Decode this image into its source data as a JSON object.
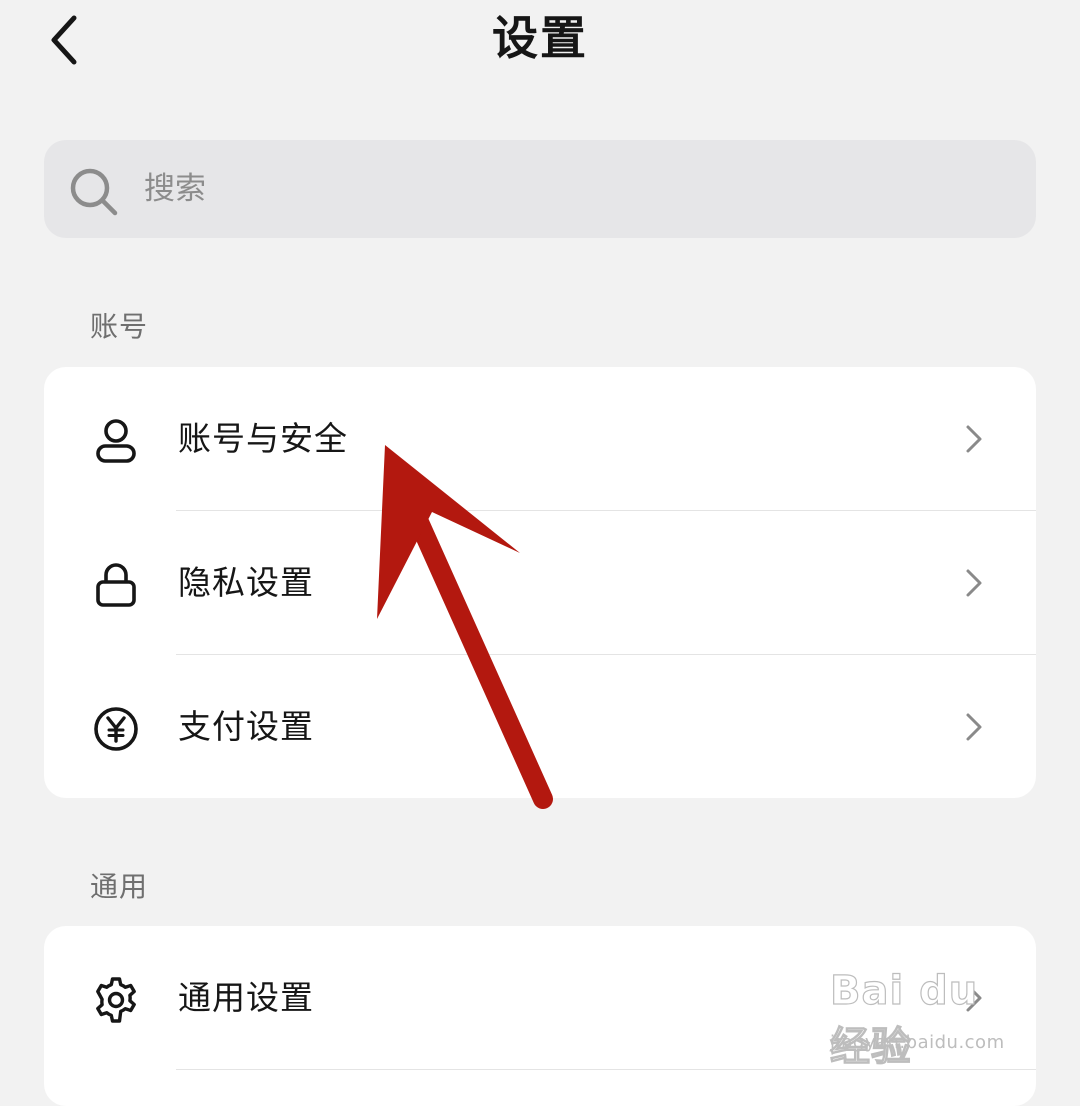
{
  "header": {
    "title": "设置",
    "back_icon": "chevron-left-icon"
  },
  "search": {
    "placeholder": "搜索",
    "value": "",
    "icon": "search-icon"
  },
  "sections": [
    {
      "label": "账号",
      "items": [
        {
          "label": "账号与安全",
          "icon": "user-icon"
        },
        {
          "label": "隐私设置",
          "icon": "lock-icon"
        },
        {
          "label": "支付设置",
          "icon": "yen-circle-icon"
        }
      ]
    },
    {
      "label": "通用",
      "items": [
        {
          "label": "通用设置",
          "icon": "gear-icon"
        }
      ]
    }
  ],
  "annotation": {
    "type": "arrow",
    "color": "#b3180f",
    "points_to": "账号与安全"
  },
  "watermark": {
    "main": "Bai du 经验",
    "sub": "jingyan.baidu.com"
  }
}
